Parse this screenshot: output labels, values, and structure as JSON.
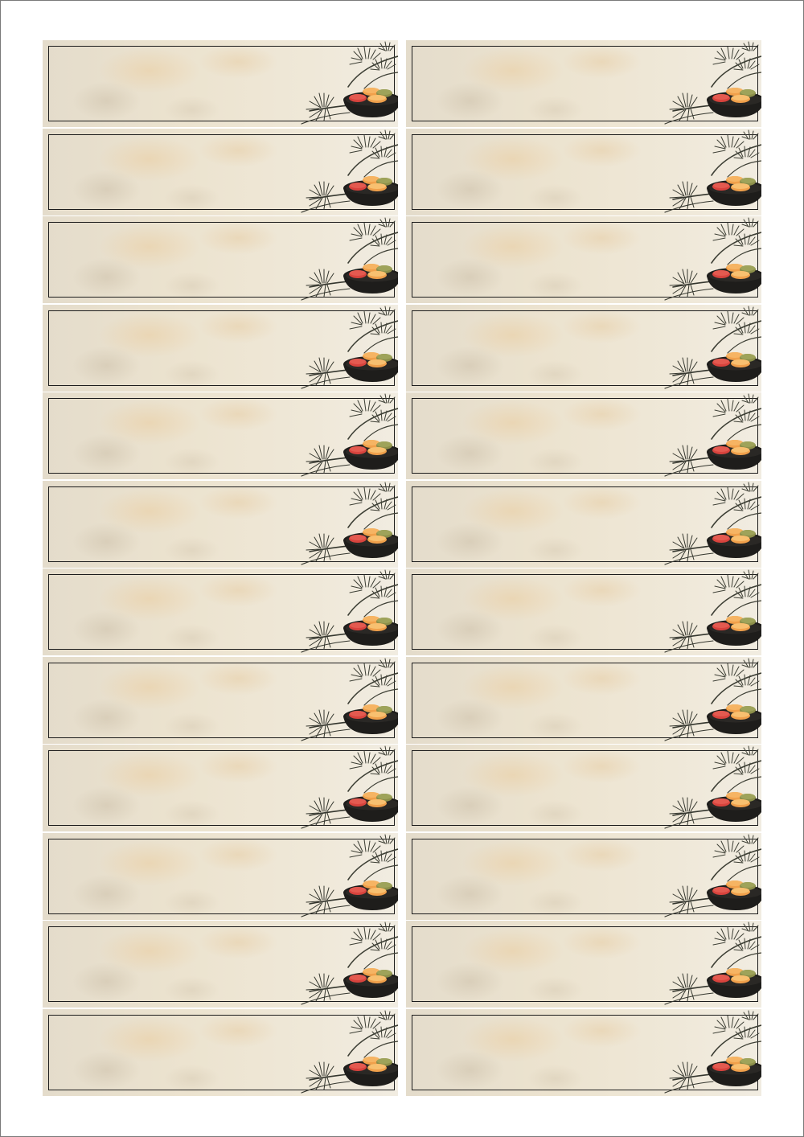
{
  "sheet": {
    "columns": 2,
    "rows": 12,
    "label_text": "",
    "decoration": "pine-branch-and-sweets-bowl-icon",
    "colors": {
      "paper": "#ece3cf",
      "frame": "#1c1c1c",
      "pine": "#3d3f35",
      "bowl": "#1e1d1b",
      "sweet_red": "#d8433d",
      "sweet_orange": "#f0a04b",
      "sweet_green": "#8c8f4a"
    }
  }
}
